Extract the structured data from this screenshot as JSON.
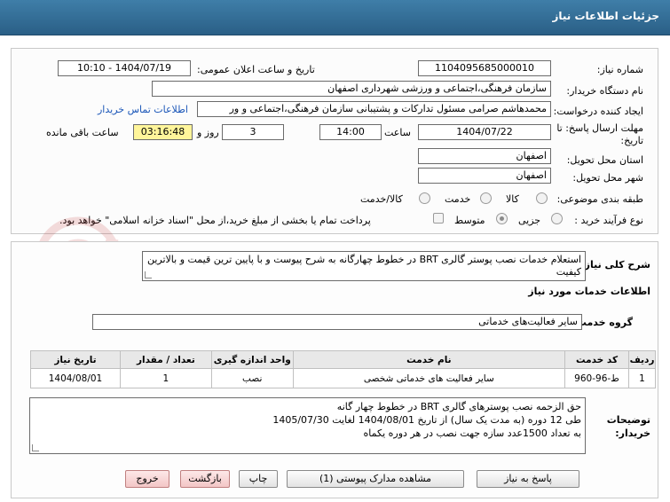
{
  "header": {
    "title": "جزئیات اطلاعات نیاز"
  },
  "form": {
    "need_number_label": "شماره نیاز:",
    "need_number": "1104095685000010",
    "announce_label": "تاریخ و ساعت اعلان عمومی:",
    "announce_value": "1404/07/19 - 10:10",
    "buyer_org_label": "نام دستگاه خریدار:",
    "buyer_org": "سازمان فرهنگی،اجتماعی و ورزشی شهرداری اصفهان",
    "creator_label": "ایجاد کننده درخواست:",
    "creator": "محمدهاشم صرامی مسئول تدارکات و پشتیبانی سازمان فرهنگی،اجتماعی و ور",
    "contact_link": "اطلاعات تماس خریدار",
    "deadline_label": "مهلت ارسال پاسخ: تا تاریخ:",
    "deadline_date": "1404/07/22",
    "time_label": "ساعت",
    "deadline_time": "14:00",
    "days_value": "3",
    "days_label": "روز و",
    "remaining_time": "03:16:48",
    "remaining_label": "ساعت باقی مانده",
    "province_label": "استان محل تحویل:",
    "province": "اصفهان",
    "city_label": "شهر محل تحویل:",
    "city": "اصفهان",
    "category_label": "طبقه بندی موضوعی:",
    "category_options": [
      "کالا",
      "خدمت",
      "کالا/خدمت"
    ],
    "purchase_type_label": "نوع فرآیند خرید :",
    "purchase_options": [
      "جزیی",
      "متوسط"
    ],
    "payment_note": "پرداخت تمام یا بخشی از مبلغ خرید،از محل \"اسناد خزانه اسلامی\" خواهد بود."
  },
  "details": {
    "summary_label": "شرح کلی نیاز:",
    "summary": "استعلام خدمات نصب پوستر گالری BRT در خطوط چهارگانه  به شرح پیوست و با پایین ترین قیمت و بالاترین کیفیت",
    "services_title": "اطلاعات خدمات مورد نیاز",
    "service_group_label": "گروه خدمت:",
    "service_group": "سایر فعالیت‌های خدماتی",
    "table": {
      "headers": [
        "ردیف",
        "کد خدمت",
        "نام خدمت",
        "واحد اندازه گیری",
        "تعداد / مقدار",
        "تاریخ نیاز"
      ],
      "rows": [
        [
          "1",
          "ط-96-960",
          "سایر فعالیت های خدماتی شخصی",
          "نصب",
          "1",
          "1404/08/01"
        ]
      ]
    },
    "buyer_notes_label": "توضیحات خریدار:",
    "buyer_notes": [
      "حق الزحمه نصب پوسترهای گالری BRT در خطوط چهار گانه",
      "طی 12 دوره (به مدت یک سال)  از تاریخ 1404/08/01 لغایت 1405/07/30",
      " به تعداد 1500عدد سازه جهت نصب در هر دوره یکماه"
    ]
  },
  "buttons": {
    "reply": "پاسخ به نیاز",
    "attachments": "مشاهده مدارک پیوستی (1)",
    "print": "چاپ",
    "back": "بازگشت",
    "exit": "خروج"
  },
  "watermark": {
    "text": "AriaTender.net"
  },
  "colors": {
    "header": "#2f6d97",
    "timer": "#fff59a",
    "link": "#1a56b8",
    "exit": "#f3c6c6"
  }
}
